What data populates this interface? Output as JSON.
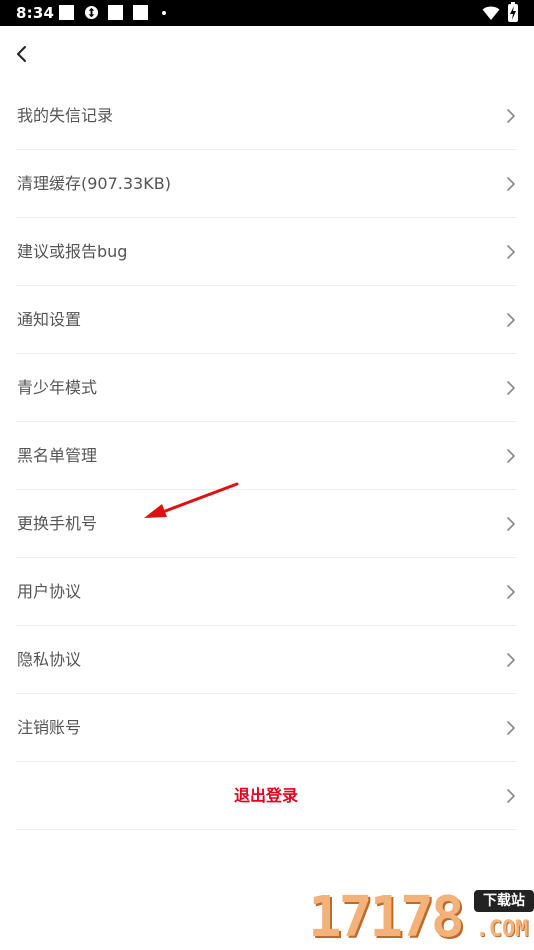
{
  "status_bar": {
    "time": "8:34"
  },
  "menu": {
    "items": [
      {
        "label": "我的失信记录",
        "name": "menu-item-credit-record"
      },
      {
        "label": "清理缓存(907.33KB)",
        "name": "menu-item-clear-cache"
      },
      {
        "label": "建议或报告bug",
        "name": "menu-item-feedback"
      },
      {
        "label": "通知设置",
        "name": "menu-item-notification-settings"
      },
      {
        "label": "青少年模式",
        "name": "menu-item-teen-mode"
      },
      {
        "label": "黑名单管理",
        "name": "menu-item-blacklist"
      },
      {
        "label": "更换手机号",
        "name": "menu-item-change-phone"
      },
      {
        "label": "用户协议",
        "name": "menu-item-user-agreement"
      },
      {
        "label": "隐私协议",
        "name": "menu-item-privacy-policy"
      },
      {
        "label": "注销账号",
        "name": "menu-item-delete-account"
      }
    ],
    "logout_label": "退出登录"
  },
  "watermark": {
    "digits": "17178",
    "badge": "下载站",
    "suffix": ".COM"
  },
  "colors": {
    "accent": "#e6001f",
    "text": "#555555",
    "divider": "#ececec",
    "chevron": "#888888",
    "status_bar": "#000000",
    "annotation_arrow": "#e01010"
  },
  "icons": {
    "back": "back-arrow-icon",
    "chevron": "chevron-right-icon",
    "wifi": "wifi-icon",
    "battery": "battery-charging-icon"
  }
}
